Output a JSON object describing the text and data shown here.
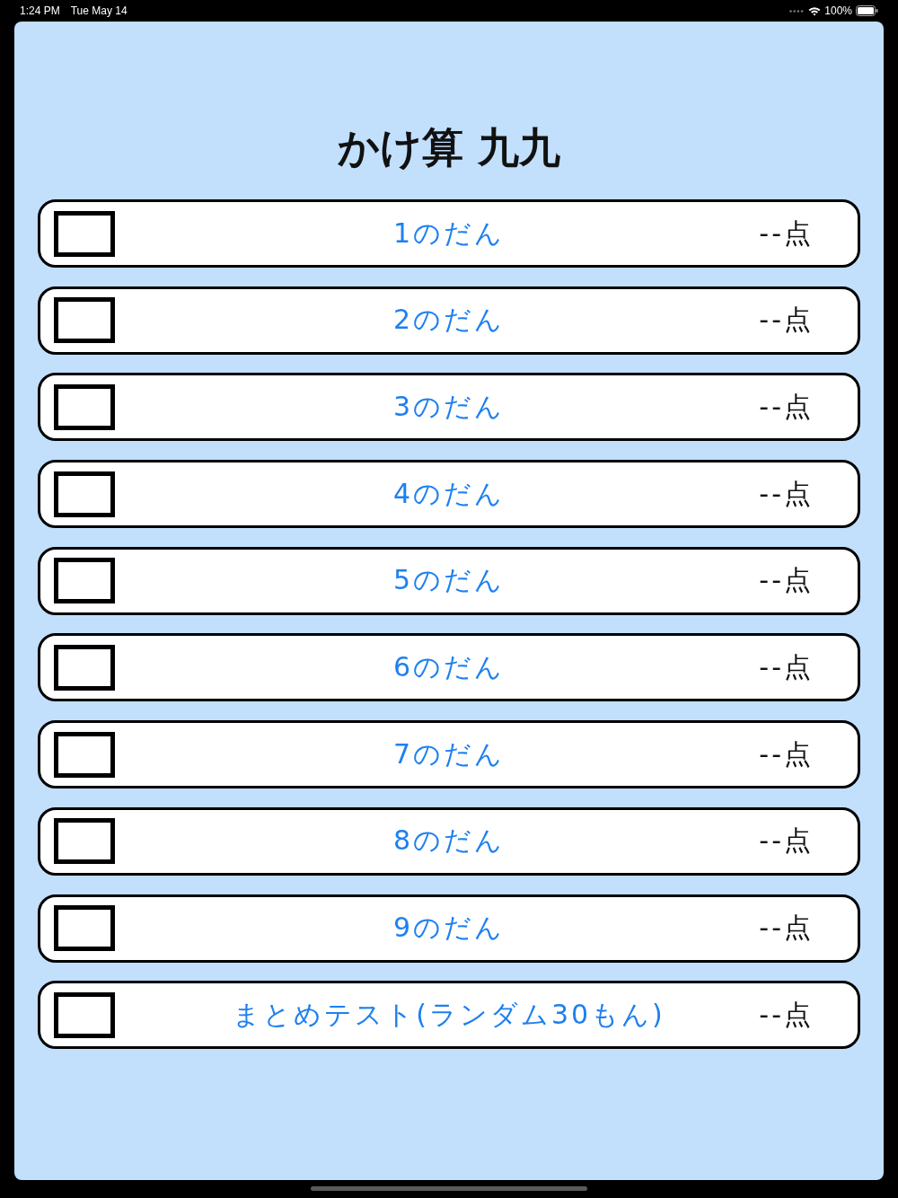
{
  "status_bar": {
    "time": "1:24 PM",
    "date": "Tue May 14",
    "battery": "100%"
  },
  "title": "かけ算 九九",
  "rows": [
    {
      "label": "1のだん",
      "score": "--点",
      "checked": false
    },
    {
      "label": "2のだん",
      "score": "--点",
      "checked": false
    },
    {
      "label": "3のだん",
      "score": "--点",
      "checked": false
    },
    {
      "label": "4のだん",
      "score": "--点",
      "checked": false
    },
    {
      "label": "5のだん",
      "score": "--点",
      "checked": false
    },
    {
      "label": "6のだん",
      "score": "--点",
      "checked": false
    },
    {
      "label": "7のだん",
      "score": "--点",
      "checked": false
    },
    {
      "label": "8のだん",
      "score": "--点",
      "checked": false
    },
    {
      "label": "9のだん",
      "score": "--点",
      "checked": false
    },
    {
      "label": "まとめテスト(ランダム30もん)",
      "score": "--点",
      "checked": false
    }
  ]
}
